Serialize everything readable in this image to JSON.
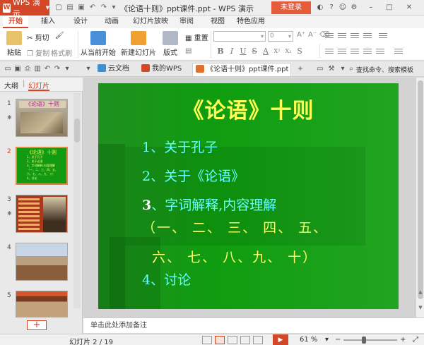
{
  "app": {
    "name": "WPS 演示",
    "window_title": "《论语十则》ppt课件.ppt - WPS 演示",
    "login_label": "未登录"
  },
  "ribbon_tabs": [
    {
      "label": "开始",
      "active": true
    },
    {
      "label": "插入"
    },
    {
      "label": "设计"
    },
    {
      "label": "动画"
    },
    {
      "label": "幻灯片放映"
    },
    {
      "label": "审阅"
    },
    {
      "label": "视图"
    },
    {
      "label": "特色应用"
    }
  ],
  "toolbar": {
    "paste": "粘贴",
    "cut": "剪切",
    "copy": "复制",
    "format_painter": "格式刷",
    "from_current": "从当前开始",
    "new_slide": "新建幻灯片",
    "layout": "版式",
    "reset": "重置",
    "font_size": "0"
  },
  "doc_tabs": [
    {
      "label": "云文档"
    },
    {
      "label": "我的WPS"
    },
    {
      "label": "《论语十则》ppt课件.ppt",
      "active": true
    }
  ],
  "search_label": "查找命令、搜索模板",
  "left_panel": {
    "tabs": [
      "大纲",
      "幻灯片"
    ],
    "active_tab": "幻灯片",
    "slides": [
      {
        "num": "1",
        "star": true
      },
      {
        "num": "2",
        "selected": true
      },
      {
        "num": "3",
        "star": true
      },
      {
        "num": "4"
      },
      {
        "num": "5"
      }
    ],
    "add_label": "+"
  },
  "slide": {
    "title": "《论语》十则",
    "line1": "1、关于孔子",
    "line2": "2、关于《论语》",
    "line3_lead": "3",
    "line3_rest": "、字词解释,内容理解",
    "line4": "（一、  二、 三、 四、 五、",
    "line5": "六、 七、  八、九、 十）",
    "line6": "4、讨论"
  },
  "thumb2": {
    "title": "《论语》十则",
    "lines": [
      "1、关于孔子",
      "2、关于论语",
      "3、字词解释,内容理解",
      "（一、二、三、四、五、",
      "六、七、八、九、十）",
      "4、讨论"
    ]
  },
  "notes_placeholder": "单击此处添加备注",
  "status": {
    "slide_counter": "幻灯片 2 / 19",
    "zoom": "61 %"
  },
  "colors": {
    "accent": "#d24726",
    "slide_bg": "#119911",
    "title_yellow": "#ffff55",
    "cyan": "#66ffff"
  }
}
